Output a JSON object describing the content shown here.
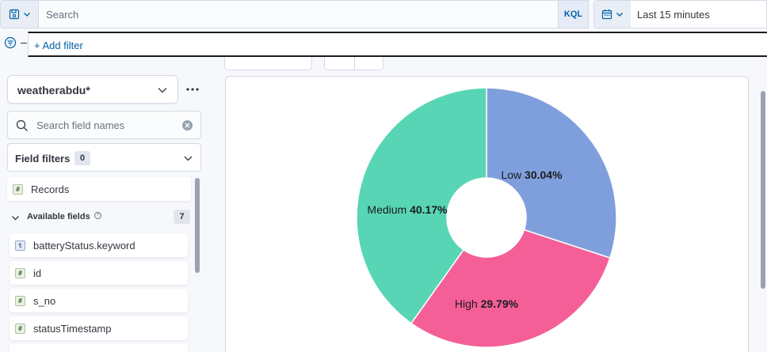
{
  "query_bar": {
    "search_placeholder": "Search",
    "language_label": "KQL",
    "time_range": "Last 15 minutes"
  },
  "filter_bar": {
    "add_filter_label": "+ Add filter"
  },
  "sidebar": {
    "index_pattern": "weatherabdu*",
    "field_search_placeholder": "Search field names",
    "field_filters_label": "Field filters",
    "field_filters_count": "0",
    "records_label": "Records",
    "records_type": "#",
    "available_fields_label": "Available fields",
    "available_fields_count": "7",
    "fields": [
      {
        "type": "t",
        "label": "batteryStatus.keyword"
      },
      {
        "type": "#",
        "label": "id"
      },
      {
        "type": "#",
        "label": "s_no"
      },
      {
        "type": "#",
        "label": "statusTimestamp"
      }
    ]
  },
  "chart_data": {
    "type": "pie",
    "donut": true,
    "slices": [
      {
        "name": "Low",
        "pct_text": "30.04%",
        "value": 30.04,
        "color": "#7f9fdc"
      },
      {
        "name": "High",
        "pct_text": "29.79%",
        "value": 29.79,
        "color": "#f45f97"
      },
      {
        "name": "Medium",
        "pct_text": "40.17%",
        "value": 40.17,
        "color": "#58d5b5"
      }
    ]
  }
}
